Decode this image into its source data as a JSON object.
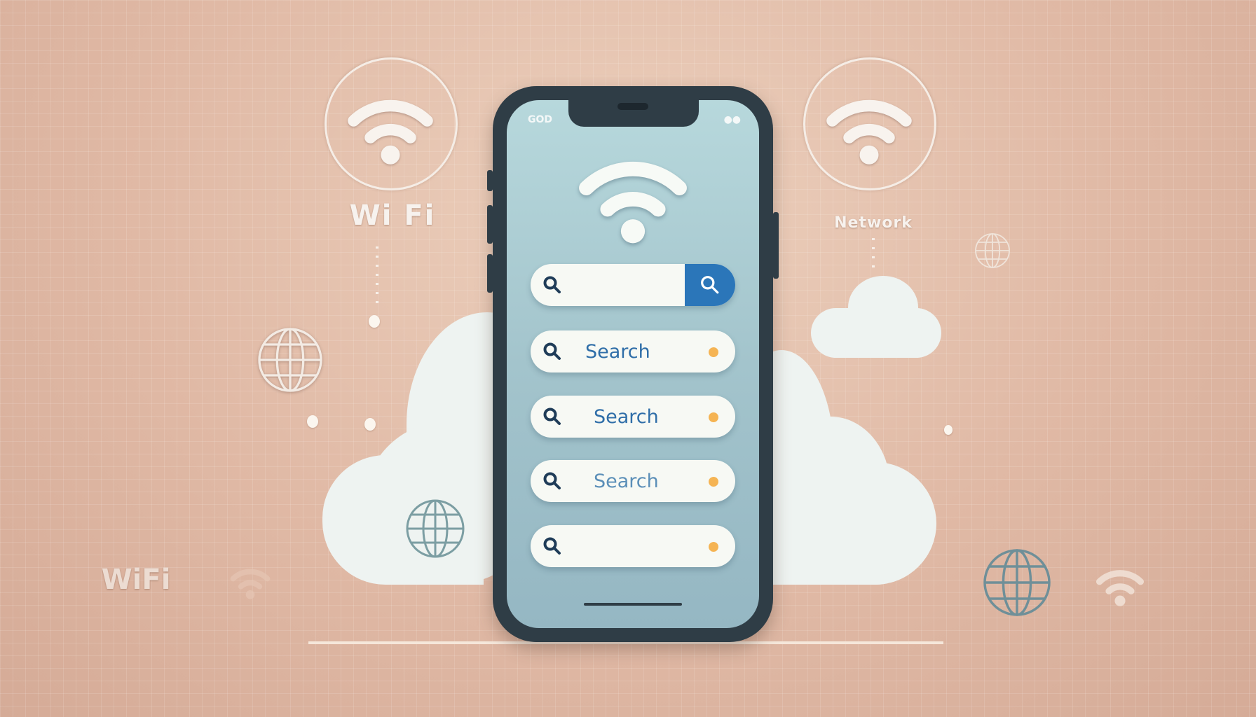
{
  "labels": {
    "wifi_top": "Wi Fi",
    "network": "Network",
    "wifi_bottom": "WiFi"
  },
  "phone": {
    "status_left": "GOD",
    "status_right": "●●",
    "main_search": {
      "placeholder": "",
      "button_icon": "search-icon"
    },
    "search_items": [
      {
        "label": "Search"
      },
      {
        "label": "Search"
      },
      {
        "label": "Search"
      },
      {
        "label": ""
      }
    ]
  },
  "colors": {
    "background": "#e0b9a5",
    "phone_frame": "#2f3d46",
    "screen": "#a3c4cc",
    "accent": "#2b76b9",
    "indicator": "#f5b453"
  }
}
